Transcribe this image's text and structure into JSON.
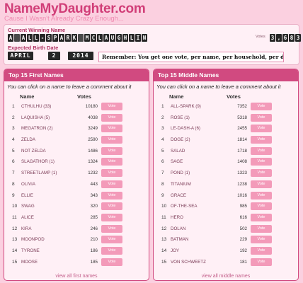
{
  "site": {
    "logo": "NameMyDaughter.com",
    "tagline": "Cause I Wasn't Already Crazy Enough..."
  },
  "status": {
    "winning_label": "Current Winning Name",
    "winning_name": "A ALL-SPARK MCLAUGHLIN",
    "votes_label": "Votes",
    "votes_count": "3,683",
    "birth_label": "Expected Birth Date",
    "birth_month": "APRIL",
    "birth_day": "2",
    "birth_year": "2014",
    "remember": "Remember: You get one vote, per name, per household, per day."
  },
  "first_names": {
    "title": "Top 15 First Names",
    "hint": "You can click on a name to leave a comment about it",
    "col_name": "Name",
    "col_votes": "Votes",
    "rows": [
      {
        "rank": "1",
        "name": "CTHULHU (33)",
        "votes": "10180",
        "button": "Vote"
      },
      {
        "rank": "2",
        "name": "LAQUISHA (5)",
        "votes": "4038",
        "button": "Vote"
      },
      {
        "rank": "3",
        "name": "MEGATRON (2)",
        "votes": "3249",
        "button": "Vote"
      },
      {
        "rank": "4",
        "name": "ZELDA",
        "votes": "2590",
        "button": "Vote"
      },
      {
        "rank": "5",
        "name": "NOT ZELDA",
        "votes": "1486",
        "button": "Vote"
      },
      {
        "rank": "6",
        "name": "SLAGATHOR (1)",
        "votes": "1324",
        "button": "Vote"
      },
      {
        "rank": "7",
        "name": "STREETLAMP (1)",
        "votes": "1232",
        "button": "Vote"
      },
      {
        "rank": "8",
        "name": "OLIVIA",
        "votes": "443",
        "button": "Vote"
      },
      {
        "rank": "9",
        "name": "ELLIE",
        "votes": "343",
        "button": "Vote"
      },
      {
        "rank": "10",
        "name": "SWAG",
        "votes": "320",
        "button": "Vote"
      },
      {
        "rank": "11",
        "name": "ALICE",
        "votes": "285",
        "button": "Vote"
      },
      {
        "rank": "12",
        "name": "KIRA",
        "votes": "246",
        "button": "Vote"
      },
      {
        "rank": "13",
        "name": "MOONPOD",
        "votes": "210",
        "button": "Vote"
      },
      {
        "rank": "14",
        "name": "TYRONE",
        "votes": "186",
        "button": "Vote"
      },
      {
        "rank": "15",
        "name": "MOOSE",
        "votes": "185",
        "button": "Vote"
      }
    ],
    "view_all": "view all first names"
  },
  "middle_names": {
    "title": "Top 15 Middle Names",
    "hint": "You can click on a name to leave a comment about it",
    "col_name": "Name",
    "col_votes": "Votes",
    "rows": [
      {
        "rank": "1",
        "name": "ALL-SPARK (9)",
        "votes": "7352",
        "button": "Vote"
      },
      {
        "rank": "2",
        "name": "ROSE (1)",
        "votes": "5318",
        "button": "Vote"
      },
      {
        "rank": "3",
        "name": "LE-DASH-A (6)",
        "votes": "2455",
        "button": "Vote"
      },
      {
        "rank": "4",
        "name": "DOGE (2)",
        "votes": "1814",
        "button": "Vote"
      },
      {
        "rank": "5",
        "name": "SALAD",
        "votes": "1718",
        "button": "Vote"
      },
      {
        "rank": "6",
        "name": "SAGE",
        "votes": "1408",
        "button": "Vote"
      },
      {
        "rank": "7",
        "name": "POND (1)",
        "votes": "1323",
        "button": "Vote"
      },
      {
        "rank": "8",
        "name": "TITANIUM",
        "votes": "1238",
        "button": "Vote"
      },
      {
        "rank": "9",
        "name": "GRACE",
        "votes": "1016",
        "button": "Vote"
      },
      {
        "rank": "10",
        "name": "OF-THE-SEA",
        "votes": "985",
        "button": "Vote"
      },
      {
        "rank": "11",
        "name": "HERO",
        "votes": "616",
        "button": "Vote"
      },
      {
        "rank": "12",
        "name": "DOLAN",
        "votes": "502",
        "button": "Vote"
      },
      {
        "rank": "13",
        "name": "BATMAN",
        "votes": "229",
        "button": "Vote"
      },
      {
        "rank": "14",
        "name": "JOY",
        "votes": "192",
        "button": "Vote"
      },
      {
        "rank": "15",
        "name": "VON SCHWEETZ",
        "votes": "181",
        "button": "Vote"
      }
    ],
    "view_all": "view all middle names"
  }
}
